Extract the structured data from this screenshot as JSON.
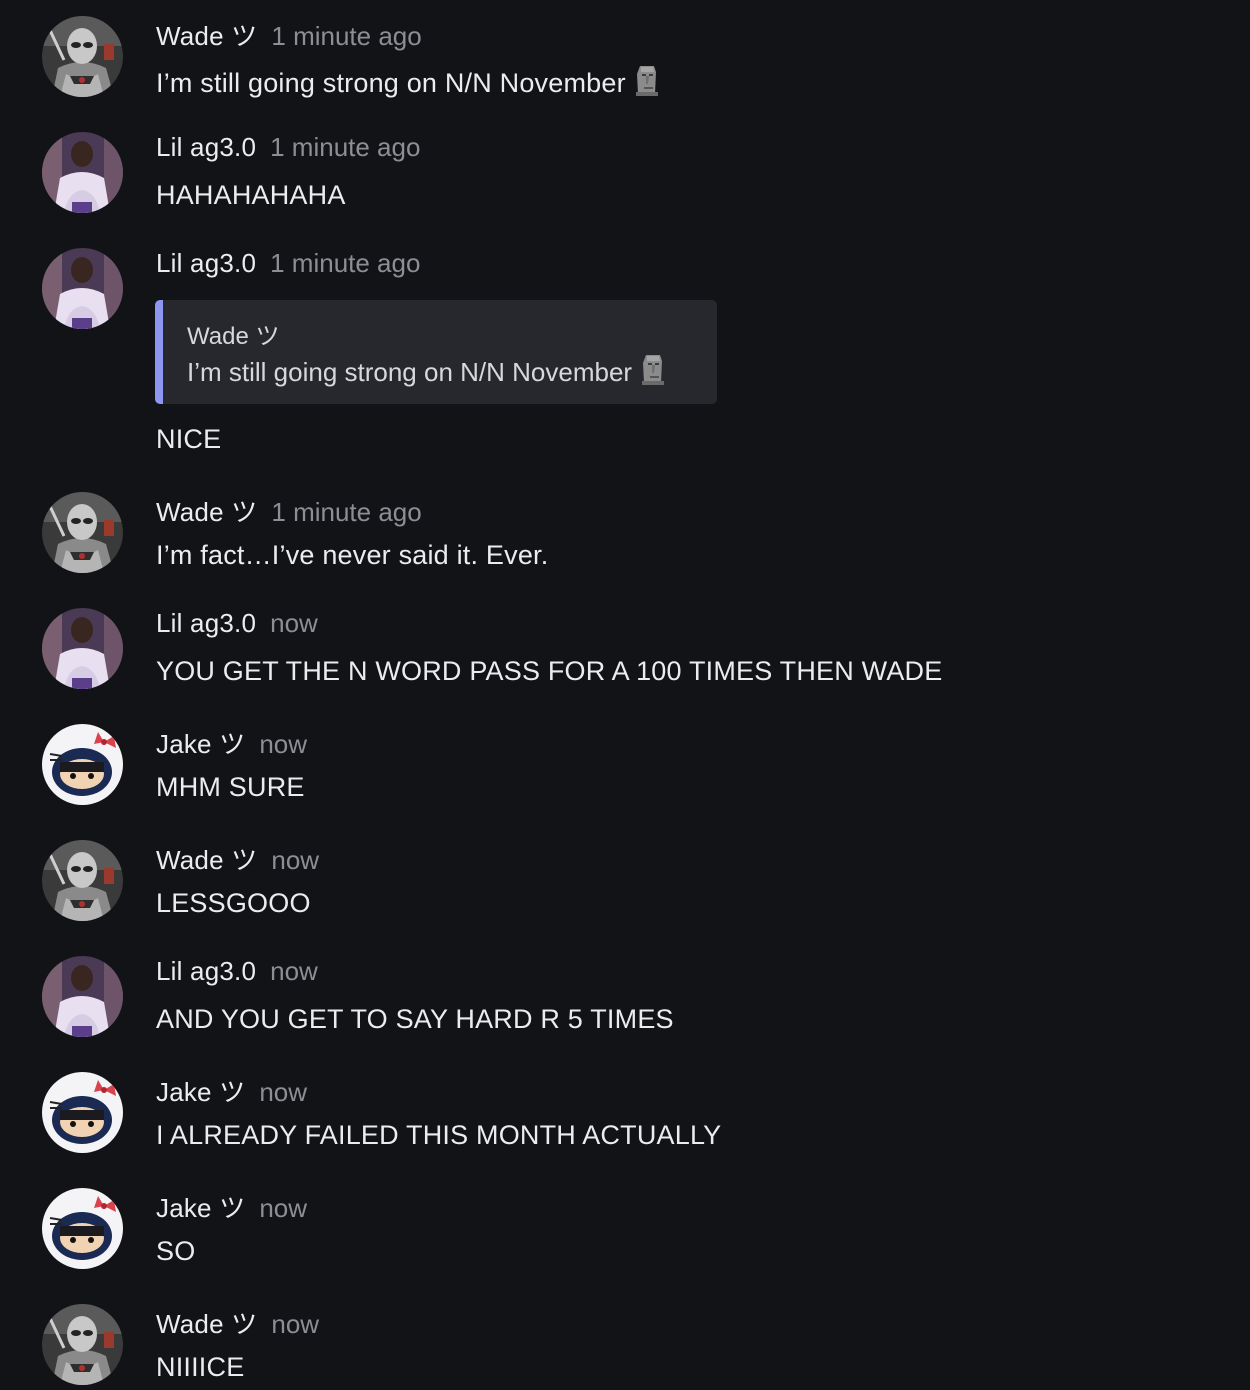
{
  "messages": [
    {
      "author": "Wade ツ",
      "time": "1 minute ago",
      "text": "I’m still going strong on N/N November",
      "emoji": "moai-emoji"
    },
    {
      "author": "Lil ag3.0",
      "time": "1 minute ago",
      "text": "HAHAHAHAHA"
    },
    {
      "author": "Lil ag3.0",
      "time": "1 minute ago",
      "text": "NICE",
      "reply": {
        "author": "Wade ツ",
        "text": "I’m still going strong on N/N November",
        "emoji": "moai-emoji"
      }
    },
    {
      "author": "Wade ツ",
      "time": "1 minute ago",
      "text": "I’m fact…I’ve never said it. Ever."
    },
    {
      "author": "Lil ag3.0",
      "time": "now",
      "text": "YOU GET THE N WORD PASS FOR A 100 TIMES THEN WADE"
    },
    {
      "author": "Jake ツ",
      "time": "now",
      "text": "MHM SURE"
    },
    {
      "author": "Wade ツ",
      "time": "now",
      "text": "LESSGOOO"
    },
    {
      "author": "Lil ag3.0",
      "time": "now",
      "text": "AND YOU GET TO SAY HARD R 5 TIMES"
    },
    {
      "author": "Jake ツ",
      "time": "now",
      "text": "I ALREADY FAILED THIS MONTH ACTUALLY"
    },
    {
      "author": "Jake ツ",
      "time": "now",
      "text": "SO"
    },
    {
      "author": "Wade ツ",
      "time": "now",
      "text": "NIIIICE"
    }
  ],
  "colors": {
    "background": "#121317",
    "quote_background": "#27282d",
    "quote_accent": "#8f96f2",
    "timestamp": "#8d8e95"
  }
}
